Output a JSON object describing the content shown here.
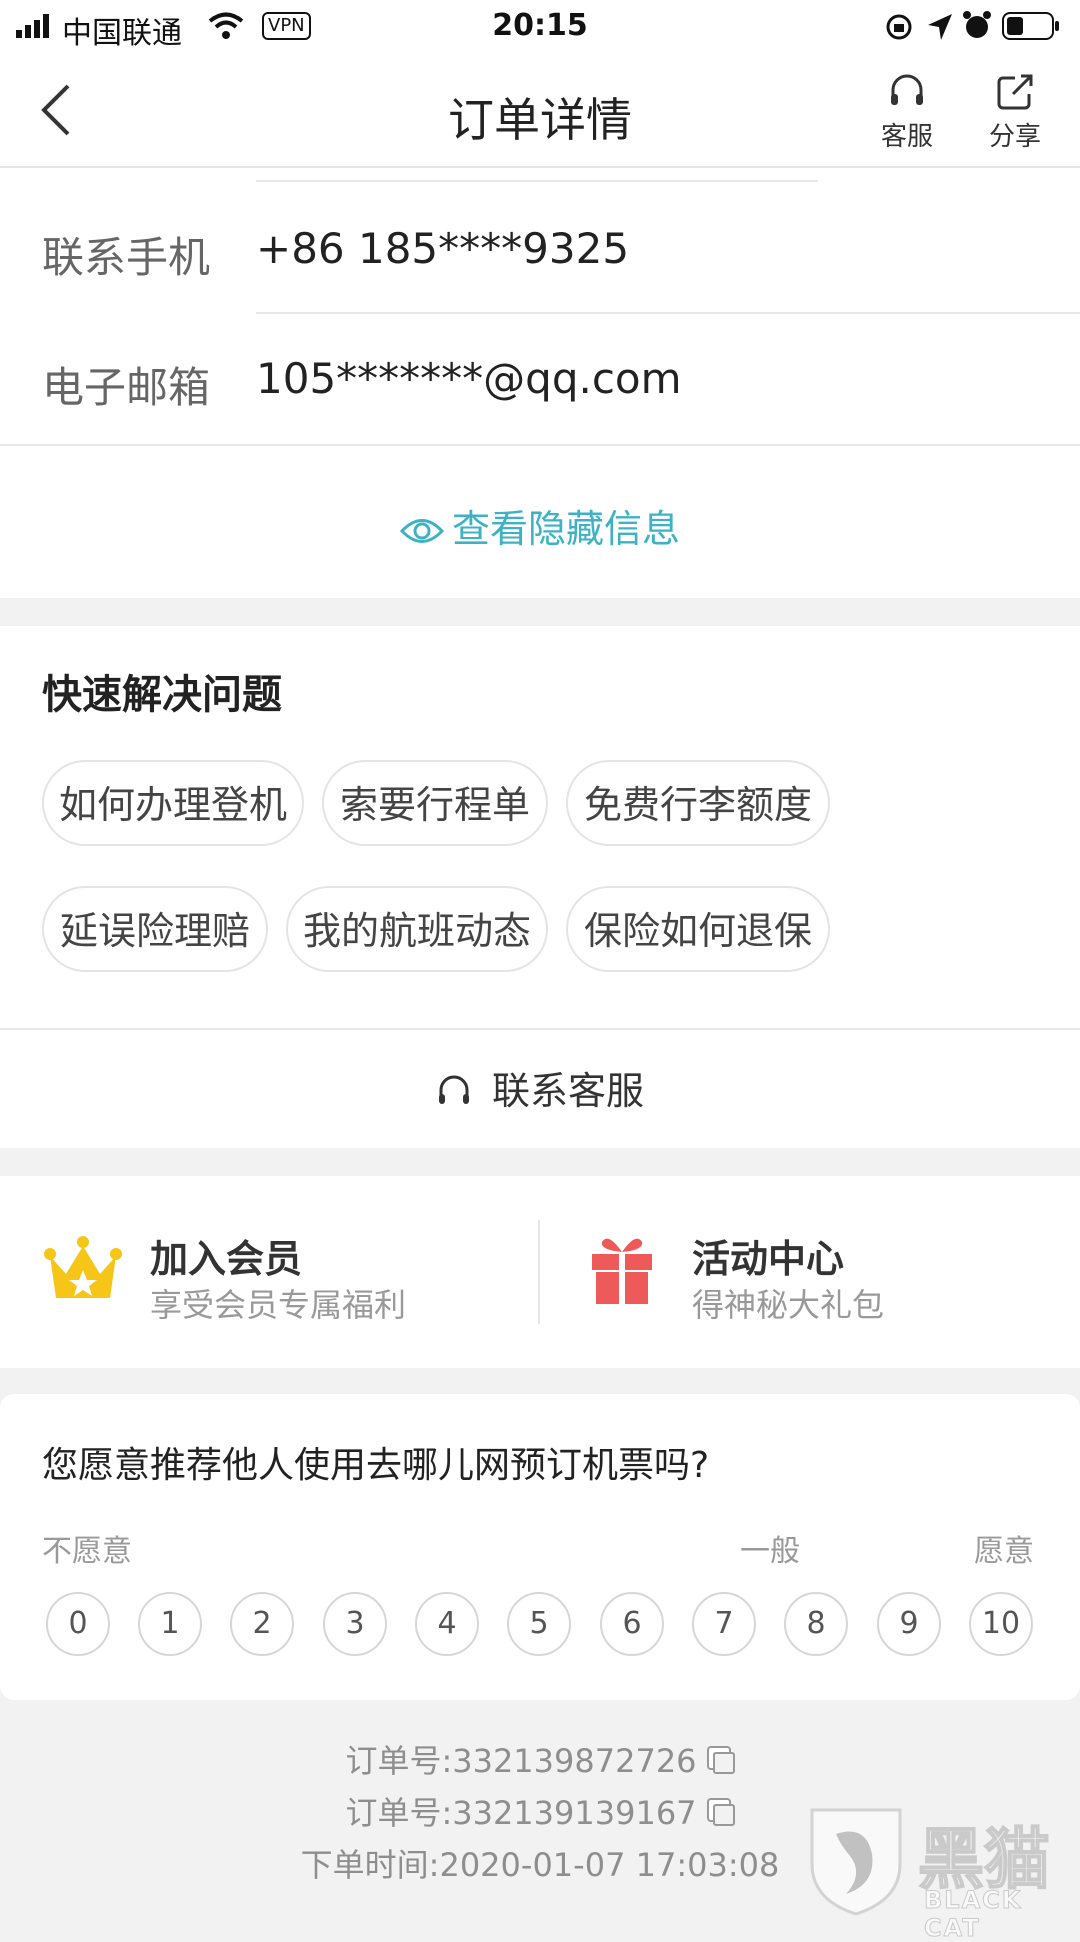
{
  "status_bar": {
    "carrier": "中国联通",
    "vpn": "VPN",
    "time": "20:15"
  },
  "nav": {
    "title": "订单详情",
    "service_label": "客服",
    "share_label": "分享"
  },
  "contact": {
    "phone_label": "联系手机",
    "phone_value": "+86 185****9325",
    "email_label": "电子邮箱",
    "email_value": "105*******@qq.com",
    "reveal_label": "查看隐藏信息"
  },
  "quick_help": {
    "title": "快速解决问题",
    "chips": [
      "如何办理登机",
      "索要行程单",
      "免费行李额度",
      "延误险理赔",
      "我的航班动态",
      "保险如何退保"
    ],
    "contact_service": "联系客服"
  },
  "promos": {
    "member": {
      "title": "加入会员",
      "subtitle": "享受会员专属福利"
    },
    "activity": {
      "title": "活动中心",
      "subtitle": "得神秘大礼包"
    }
  },
  "survey": {
    "question": "您愿意推荐他人使用去哪儿网预订机票吗?",
    "label_low": "不愿意",
    "label_mid": "一般",
    "label_high": "愿意",
    "scores": [
      "0",
      "1",
      "2",
      "3",
      "4",
      "5",
      "6",
      "7",
      "8",
      "9",
      "10"
    ]
  },
  "footer": {
    "order_no_1": "订单号:332139872726",
    "order_no_2": "订单号:332139139167",
    "order_time": "下单时间:2020-01-07 17:03:08"
  },
  "watermark": {
    "cn": "黑猫",
    "en": "BLACK CAT"
  },
  "colors": {
    "accent_teal": "#3db2c4",
    "crown_gold": "#f5c518",
    "gift_red": "#ee5a5a"
  }
}
